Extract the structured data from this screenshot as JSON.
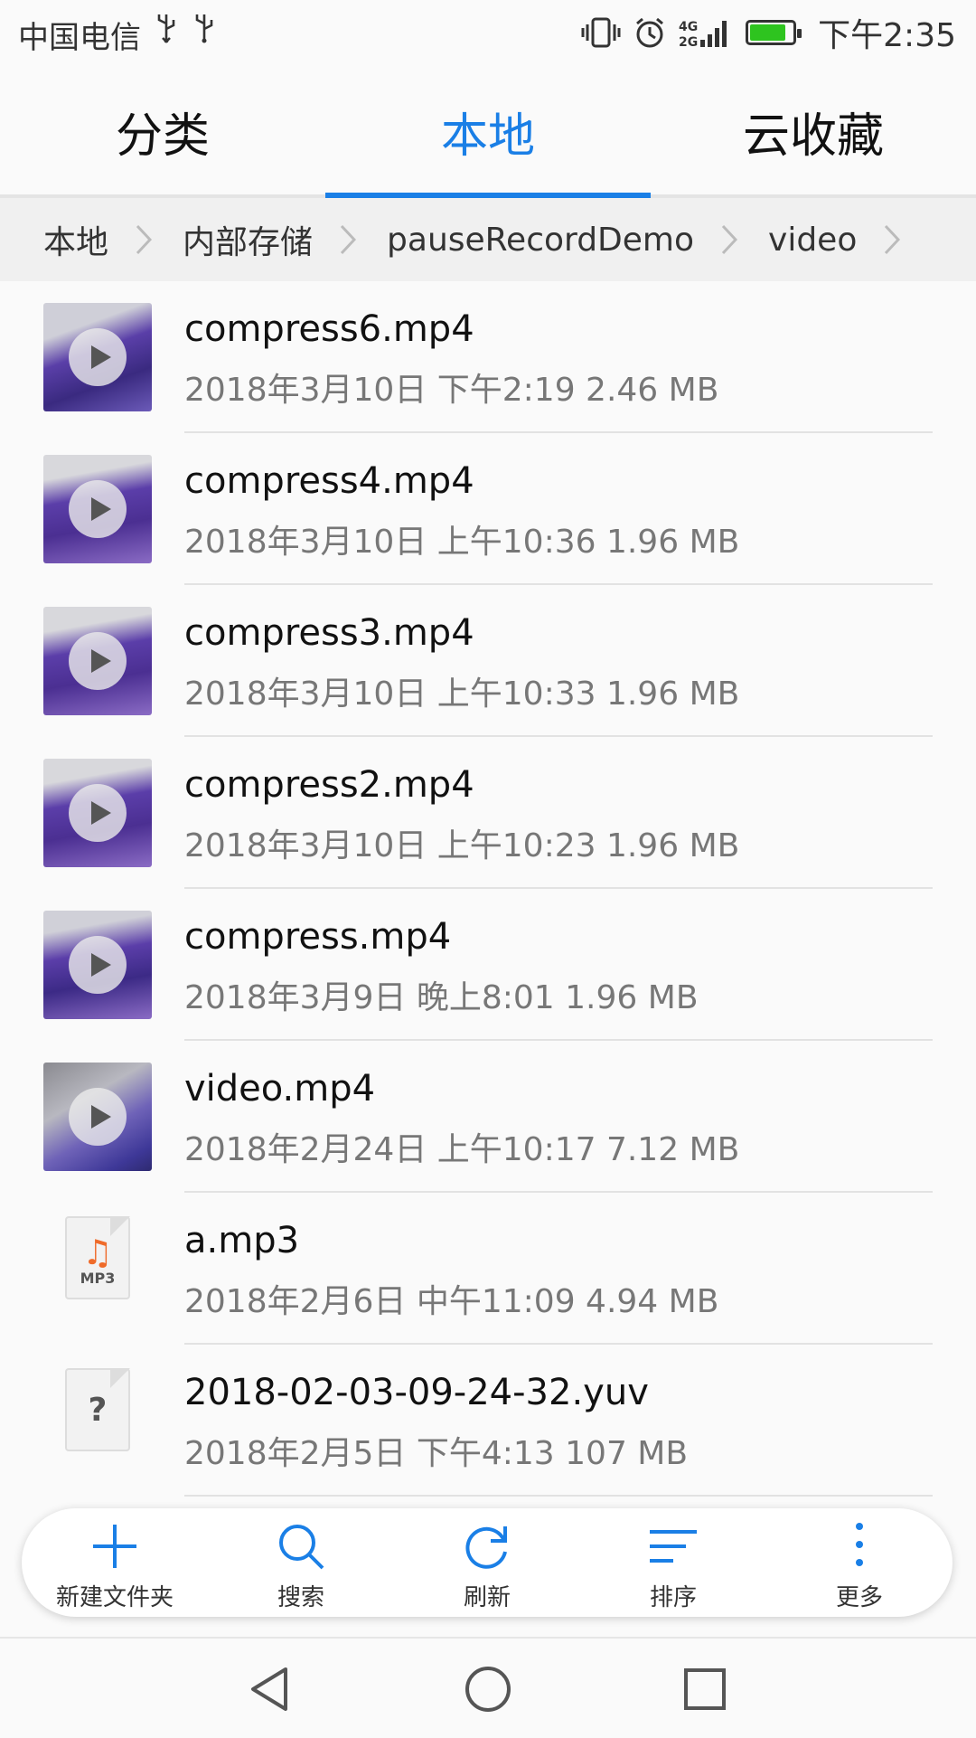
{
  "status_bar": {
    "carrier": "中国电信",
    "time": "下午2:35",
    "battery_level": 0.85,
    "icons": [
      "usb-icon",
      "usb-icon",
      "vibrate-icon",
      "alarm-icon",
      "signal-4g-icon",
      "battery-icon"
    ],
    "colors": {
      "battery_fill": "#2ec41f"
    }
  },
  "tabs": [
    {
      "label": "分类",
      "active": false
    },
    {
      "label": "本地",
      "active": true
    },
    {
      "label": "云收藏",
      "active": false
    }
  ],
  "accent_color": "#1a7fe6",
  "breadcrumb": [
    "本地",
    "内部存储",
    "pauseRecordDemo",
    "video"
  ],
  "files": [
    {
      "name": "compress6.mp4",
      "meta": "2018年3月10日 下午2:19 2.46 MB",
      "type": "video"
    },
    {
      "name": "compress4.mp4",
      "meta": "2018年3月10日 上午10:36 1.96 MB",
      "type": "video"
    },
    {
      "name": "compress3.mp4",
      "meta": "2018年3月10日 上午10:33 1.96 MB",
      "type": "video"
    },
    {
      "name": "compress2.mp4",
      "meta": "2018年3月10日 上午10:23 1.96 MB",
      "type": "video"
    },
    {
      "name": "compress.mp4",
      "meta": "2018年3月9日 晚上8:01 1.96 MB",
      "type": "video"
    },
    {
      "name": "video.mp4",
      "meta": "2018年2月24日 上午10:17 7.12 MB",
      "type": "video"
    },
    {
      "name": "a.mp3",
      "meta": "2018年2月6日 中午11:09 4.94 MB",
      "type": "audio",
      "icon_tag": "MP3"
    },
    {
      "name": "2018-02-03-09-24-32.yuv",
      "meta": "2018年2月5日 下午4:13 107 MB",
      "type": "unknown",
      "icon_glyph": "?"
    }
  ],
  "actions": [
    {
      "label": "新建文件夹",
      "icon": "plus-icon"
    },
    {
      "label": "搜索",
      "icon": "search-icon"
    },
    {
      "label": "刷新",
      "icon": "refresh-icon"
    },
    {
      "label": "排序",
      "icon": "sort-icon"
    },
    {
      "label": "更多",
      "icon": "more-icon"
    }
  ],
  "nav": [
    "back-icon",
    "home-icon",
    "recents-icon"
  ]
}
